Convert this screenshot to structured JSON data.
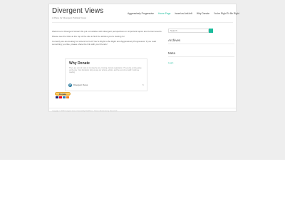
{
  "header": {
    "site_title": "Divergent Views",
    "site_description": "A Place for Divergent Political Views"
  },
  "nav": {
    "items": [
      {
        "label": "Aggressively Progressive"
      },
      {
        "label": "Home Page"
      },
      {
        "label": "Israel as Anti-left"
      },
      {
        "label": "Why Donate"
      },
      {
        "label": "You're Right To Be Right"
      }
    ],
    "active_index": 1
  },
  "main": {
    "paragraphs": [
      "Welcome to Divergent Views! We put out articles with divergent perspectives on important topics and current events.",
      "Please see the links at the top of the site to find the articles you're looking for.",
      "Currently we are looking for writers for both You're Right to Be Right and Aggressively Progressive! If you read something you like, please share the link with your friends!"
    ],
    "embed": {
      "title": "Why Donate",
      "excerpt": "There are a lot of costs to running the site, hosting, domain registration, IT security, and keeping up the site. Your donations help us pay our writers, editors, and the rest of our staff. Continue reading",
      "site_name": "Divergent Views"
    },
    "donate_label": "Donate"
  },
  "sidebar": {
    "search_placeholder": "Search",
    "archives_title": "Archives",
    "meta_title": "Meta",
    "login_label": "Login"
  },
  "footer": {
    "text": "Copyright © 2024 Divergent Views. Powered by WordPress. Theme: Accelerate by ThemeGrill."
  },
  "colors": {
    "accent": "#1abc9c",
    "page_background": "#eeeeee"
  },
  "icons": {
    "embed_site": "wordpress-icon",
    "share": "share-icon",
    "search": "search-icon"
  }
}
